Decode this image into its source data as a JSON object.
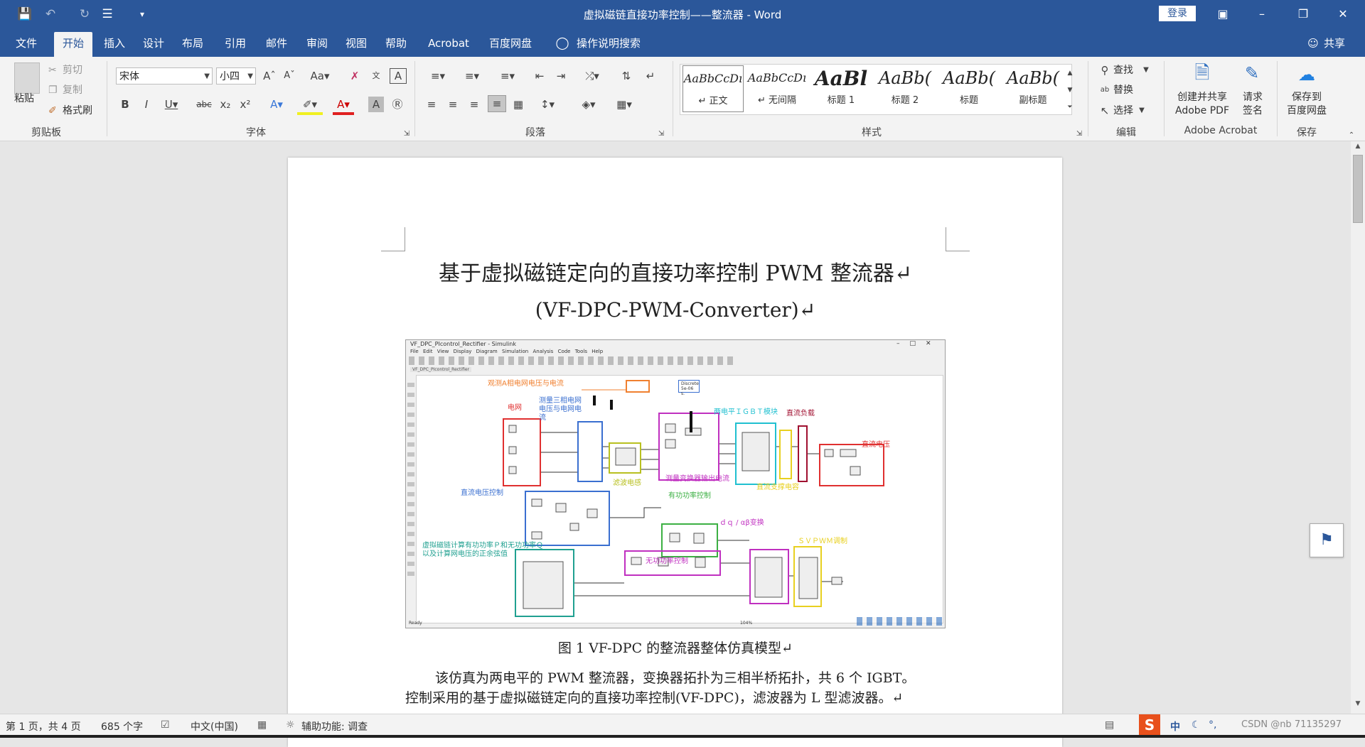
{
  "window": {
    "title": "虚拟磁链直接功率控制——整流器 - Word",
    "login_label": "登录",
    "share_label": "共享"
  },
  "tabs": [
    "文件",
    "开始",
    "插入",
    "设计",
    "布局",
    "引用",
    "邮件",
    "审阅",
    "视图",
    "帮助",
    "Acrobat",
    "百度网盘"
  ],
  "search_tell": "操作说明搜索",
  "ribbon": {
    "clipboard": {
      "paste": "粘贴",
      "cut": "剪切",
      "copy": "复制",
      "format_painter": "格式刷",
      "group": "剪贴板"
    },
    "font": {
      "name": "宋体",
      "size": "小四",
      "group": "字体"
    },
    "paragraph": {
      "group": "段落"
    },
    "styles": {
      "group": "样式",
      "items": [
        {
          "sample": "AaBbCcDı",
          "name": "↵ 正文"
        },
        {
          "sample": "AaBbCcDı",
          "name": "↵ 无间隔"
        },
        {
          "sample": "AaBl",
          "name": "标题 1"
        },
        {
          "sample": "AaBb(",
          "name": "标题 2"
        },
        {
          "sample": "AaBb(",
          "name": "标题"
        },
        {
          "sample": "AaBb(",
          "name": "副标题"
        }
      ]
    },
    "editing": {
      "find": "查找",
      "replace": "替换",
      "select": "选择",
      "group": "编辑"
    },
    "acrobat": {
      "create_share": "创建并共享",
      "create_share_2": "Adobe PDF",
      "request_sign": "请求",
      "request_sign_2": "签名",
      "group": "Adobe Acrobat"
    },
    "save": {
      "save_to": "保存到",
      "save_to_2": "百度网盘",
      "group": "保存"
    }
  },
  "document": {
    "title_line1": "基于虚拟磁链定向的直接功率控制 PWM 整流器↵",
    "title_line2": "(VF-DPC-PWM-Converter)↵",
    "caption": "图 1 VF-DPC 的整流器整体仿真模型↵",
    "para1": "该仿真为两电平的 PWM 整流器，变换器拓扑为三相半桥拓扑，共 6 个 IGBT。",
    "para2": "控制采用的基于虚拟磁链定向的直接功率控制(VF-DPC)，滤波器为 L 型滤波器。↵"
  },
  "figure": {
    "window_title": "VF_DPC_PIcontrol_Rectifier - Simulink",
    "menu": [
      "File",
      "Edit",
      "View",
      "Display",
      "Diagram",
      "Simulation",
      "Analysis",
      "Code",
      "Tools",
      "Help"
    ],
    "breadcrumb": "VF_DPC_PIcontrol_Rectifier",
    "status_ready": "Ready",
    "zoom": "104%",
    "labels": {
      "observe": "观测A相电网电压与电流",
      "discrete": "Discrete 5e-06 s.",
      "grid": "电网",
      "measure": "测量三相电网电压与电网电流",
      "filter_inductor": "滤波电感",
      "measure_conv": "测量变换器输出电流",
      "igbt": "两电平ＩＧＢＴ模块",
      "dc_load": "直流负载",
      "dc_cap": "直流支撑电容",
      "dc_voltage": "直流电压",
      "dc_voltage_ctrl": "直流电压控制",
      "active_power": "有功功率控制",
      "dq_ab": "ｄｑ / αβ变换",
      "svpwm": "ＳＶＰＷＭ调制",
      "vf_calc": "虚拟磁链计算有功功率Ｐ和无功功率Ｑ以及计算网电压的正余弦值",
      "reactive_power": "无功功率控制"
    }
  },
  "status": {
    "page": "第 1 页，共 4 页",
    "words": "685 个字",
    "lang": "中文(中国)",
    "accessibility": "辅助功能: 调查",
    "ime": "中",
    "watermark": "CSDN @nb 71135297"
  },
  "colors": {
    "brand": "#2b579a",
    "orange": "#f08030",
    "red": "#e03030",
    "blue": "#3a6fd0",
    "green": "#3cb043",
    "magenta": "#c030c0",
    "cyan": "#20c0d0",
    "yellow": "#e8d020",
    "teal": "#20a090"
  }
}
